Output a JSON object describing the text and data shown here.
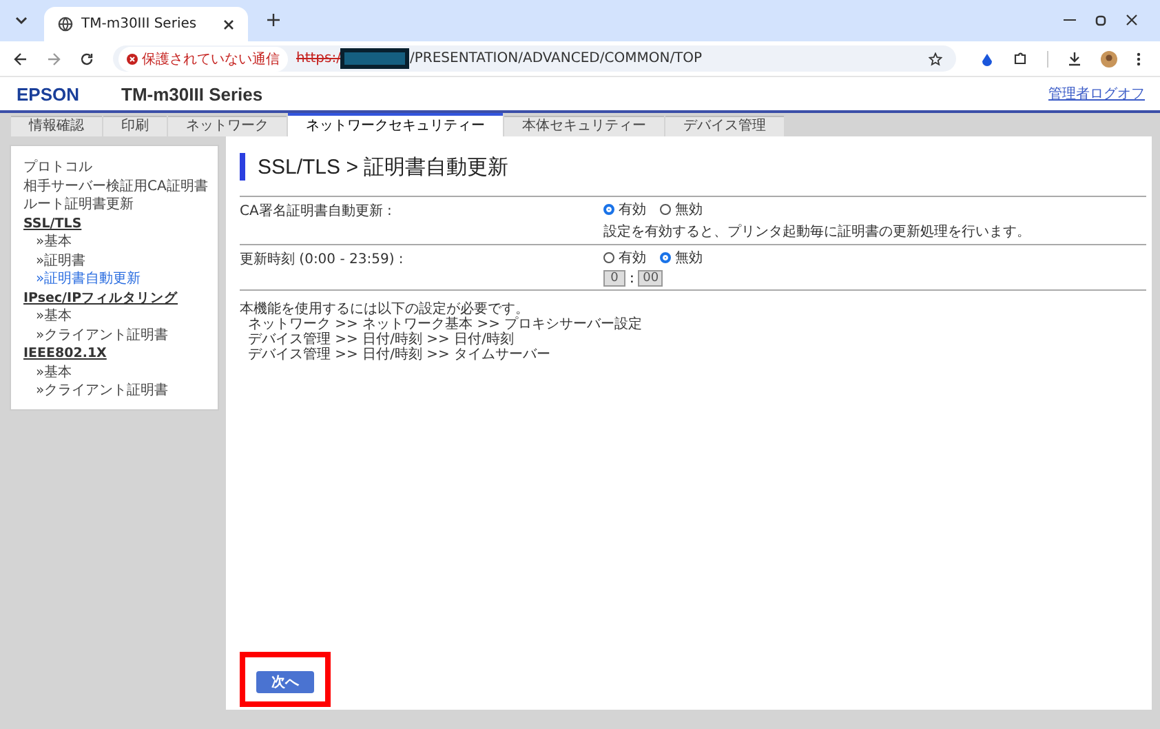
{
  "browser": {
    "tab_title": "TM-m30III Series",
    "security_label": "保護されていない通信",
    "url_scheme": "https:/",
    "url_rest": "/PRESENTATION/ADVANCED/COMMON/TOP"
  },
  "header": {
    "logo": "EPSON",
    "title": "TM-m30III Series",
    "logoff": "管理者ログオフ"
  },
  "tabs": [
    {
      "label": "情報確認",
      "selected": false
    },
    {
      "label": "印刷",
      "selected": false
    },
    {
      "label": "ネットワーク",
      "selected": false
    },
    {
      "label": "ネットワークセキュリティー",
      "selected": true
    },
    {
      "label": "本体セキュリティー",
      "selected": false
    },
    {
      "label": "デバイス管理",
      "selected": false
    }
  ],
  "sidebar": {
    "items": [
      {
        "kind": "link",
        "label": "プロトコル",
        "selected": false
      },
      {
        "kind": "link",
        "label": "相手サーバー検証用CA証明書",
        "selected": false
      },
      {
        "kind": "link",
        "label": "ルート証明書更新",
        "selected": false
      },
      {
        "kind": "heading",
        "label": "SSL/TLS",
        "selected": false
      },
      {
        "kind": "sub",
        "label": "»基本",
        "selected": false
      },
      {
        "kind": "sub",
        "label": "»証明書",
        "selected": false
      },
      {
        "kind": "sub",
        "label": "»証明書自動更新",
        "selected": true
      },
      {
        "kind": "heading",
        "label": "IPsec/IPフィルタリング",
        "selected": false
      },
      {
        "kind": "sub",
        "label": "»基本",
        "selected": false
      },
      {
        "kind": "sub",
        "label": "»クライアント証明書",
        "selected": false
      },
      {
        "kind": "heading",
        "label": "IEEE802.1X",
        "selected": false
      },
      {
        "kind": "sub",
        "label": "»基本",
        "selected": false
      },
      {
        "kind": "sub",
        "label": "»クライアント証明書",
        "selected": false
      }
    ]
  },
  "page_title": "SSL/TLS > 証明書自動更新",
  "settings": [
    {
      "label": "CA署名証明書自動更新 :",
      "options": [
        {
          "label": "有効",
          "selected": true
        },
        {
          "label": "無効",
          "selected": false
        }
      ],
      "note": "設定を有効すると、プリンタ起動毎に証明書の更新処理を行います。"
    },
    {
      "label": "更新時刻 (0:00 - 23:59) :",
      "options": [
        {
          "label": "有効",
          "selected": false
        },
        {
          "label": "無効",
          "selected": true
        }
      ],
      "time": {
        "hour": "0",
        "separator": ":",
        "minute": "00",
        "disabled": true
      }
    }
  ],
  "requirements": [
    "本機能を使用するには以下の設定が必要です。",
    "ネットワーク >> ネットワーク基本 >> プロキシサーバー設定",
    "デバイス管理 >> 日付/時刻 >> 日付/時刻",
    "デバイス管理 >> 日付/時刻 >> タイムサーバー"
  ],
  "next_button": "次へ"
}
